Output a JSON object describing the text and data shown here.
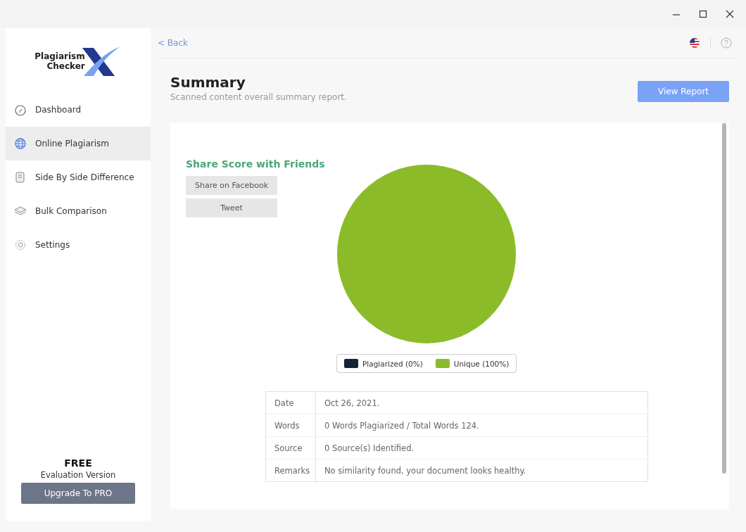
{
  "window": {
    "controls": [
      {
        "kind": "minimize"
      },
      {
        "kind": "maximize"
      },
      {
        "kind": "close"
      }
    ]
  },
  "sidebar": {
    "logo": {
      "line1": "Plagiarism",
      "line2": "Checker"
    },
    "items": [
      {
        "label": "Dashboard",
        "selected": false
      },
      {
        "label": "Online Plagiarism",
        "selected": true
      },
      {
        "label": "Side By Side Difference",
        "selected": false
      },
      {
        "label": "Bulk Comparison",
        "selected": false
      },
      {
        "label": "Settings",
        "selected": false
      }
    ],
    "plan": "FREE",
    "plan_note": "Evaluation Version",
    "upgrade_button": "Upgrade To PRO"
  },
  "topbar": {
    "back": "< Back"
  },
  "header": {
    "title": "Summary",
    "subtitle": "Scanned content overall summary report.",
    "button": "View Report"
  },
  "share": {
    "title": "Share Score with Friends",
    "buttons": [
      "Share on Facebook",
      "Tweet"
    ]
  },
  "chart": {
    "chart_data": {
      "type": "pie",
      "categories": [
        "Plagiarized (0%)",
        "Unique (100%)"
      ],
      "values": [
        0,
        100
      ],
      "colors": [
        "#14253a",
        "#8cbb2a"
      ]
    }
  },
  "details": [
    {
      "label": "Date",
      "value": "Oct 26, 2021."
    },
    {
      "label": "Words",
      "value": "0 Words Plagiarized / Total Words 124."
    },
    {
      "label": "Source",
      "value": "0 Source(s) Identified."
    },
    {
      "label": "Remarks",
      "value": "No similarity found, your document looks healthy."
    }
  ]
}
